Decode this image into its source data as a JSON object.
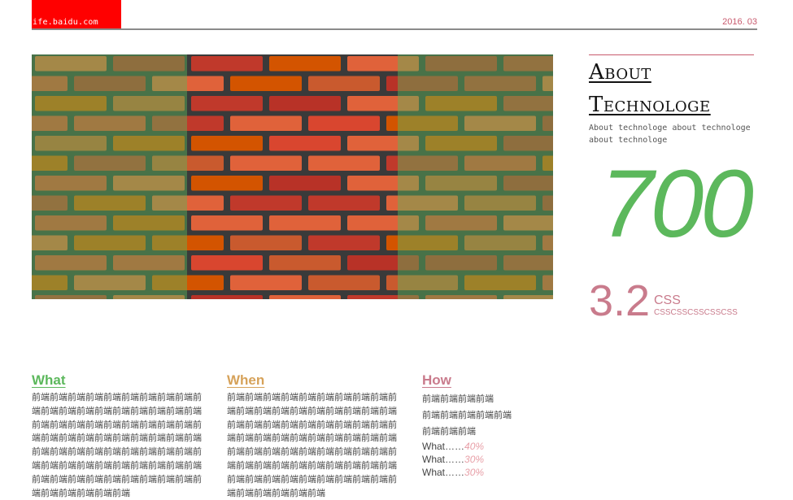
{
  "header": {
    "logo_text": "ife.baidu.com",
    "date": "2016. 03"
  },
  "hero": {
    "image_name": "brick-wall",
    "overlay_left_color": "#5cb85c",
    "overlay_right_color": "#5cb85c"
  },
  "about": {
    "title_line1": "About",
    "title_line2": "Technologe",
    "description": "About technologe about technologe about technologe",
    "big_number": "700",
    "version": "3.2",
    "css_label": "CSS",
    "css_sub": "CSSCSSCSSCSSCSS"
  },
  "columns": {
    "what": {
      "title": "What",
      "body": "前端前端前端前端前端前端前端前端前端前端前端前端前端前端前端前端前端前端前端前端前端前端前端前端前端前端前端前端前端前端前端前端前端前端前端前端前端前端前端前端前端前端前端前端前端前端前端前端前端前端前端前端前端前端前端前端前端前端前端前端前端前端前端前端前端前端前端前端前端前端前端前端"
    },
    "when": {
      "title": "When",
      "body": "前端前端前端前端前端前端前端前端前端前端前端前端前端前端前端前端前端前端前端前端前端前端前端前端前端前端前端前端前端前端前端前端前端前端前端前端前端前端前端前端前端前端前端前端前端前端前端前端前端前端前端前端前端前端前端前端前端前端前端前端前端前端前端前端前端前端前端前端前端前端前端前端"
    },
    "how": {
      "title": "How",
      "lines": [
        "前端前端前端前端",
        "前端前端前端前端前端",
        "前端前端前端"
      ],
      "stats": [
        {
          "label": "What……",
          "value": "40%"
        },
        {
          "label": "What……",
          "value": "30%"
        },
        {
          "label": "What……",
          "value": "30%"
        }
      ]
    }
  },
  "colors": {
    "accent_red": "#ff0000",
    "accent_pink": "#c97b8c",
    "accent_green": "#5cb85c",
    "accent_orange": "#d6a25a"
  }
}
